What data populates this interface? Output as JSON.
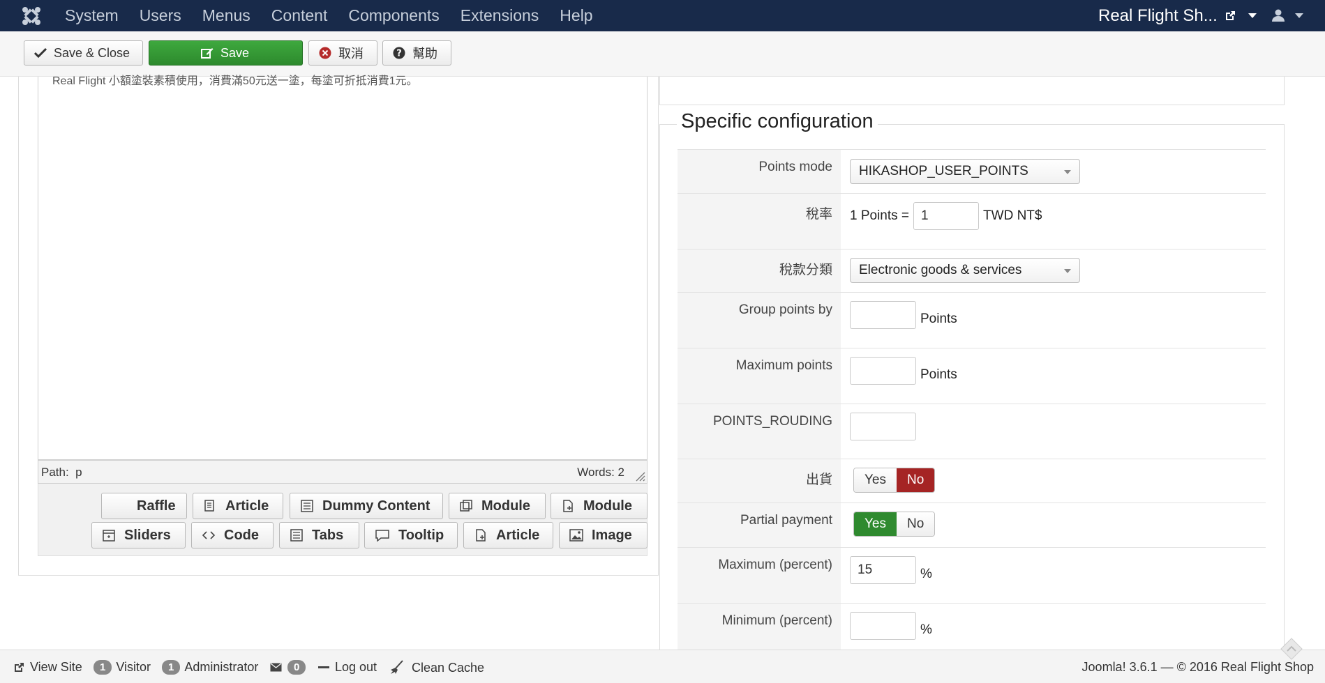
{
  "navbar": {
    "menu": [
      "System",
      "Users",
      "Menus",
      "Content",
      "Components",
      "Extensions",
      "Help"
    ],
    "site_name": "Real Flight Sh..."
  },
  "toolbar": {
    "save_close": "Save & Close",
    "save": "Save",
    "cancel": "取消",
    "help": "幫助"
  },
  "editor": {
    "text": "Real Flight 小額塗裝素積使用，消費滿50元送一塗，每塗可折抵消費1元。",
    "path_label": "Path:",
    "path_value": "p",
    "words_label": "Words: 2"
  },
  "editor_buttons": {
    "row1": [
      "Raffle",
      "Article",
      "Dummy Content",
      "Module",
      "Module"
    ],
    "row2": [
      "Sliders",
      "Code",
      "Tabs",
      "Tooltip",
      "Article",
      "Image"
    ]
  },
  "config": {
    "legend": "Specific configuration",
    "points_mode_label": "Points mode",
    "points_mode_value": "HIKASHOP_USER_POINTS",
    "rate_label": "稅率",
    "rate_prefix": "1 Points =",
    "rate_value": "1",
    "rate_suffix": "TWD NT$",
    "tax_category_label": "稅款分類",
    "tax_category_value": "Electronic goods & services",
    "group_points_label": "Group points by",
    "group_points_value": "",
    "group_points_unit": "Points",
    "max_points_label": "Maximum points",
    "max_points_value": "",
    "max_points_unit": "Points",
    "rounding_label": "POINTS_ROUDING",
    "rounding_value": "",
    "shipping_label": "出貨",
    "shipping_yes": "Yes",
    "shipping_no": "No",
    "partial_label": "Partial payment",
    "partial_yes": "Yes",
    "partial_no": "No",
    "max_percent_label": "Maximum (percent)",
    "max_percent_value": "15",
    "max_percent_unit": "%",
    "min_percent_label": "Minimum (percent)",
    "min_percent_value": "",
    "min_percent_unit": "%"
  },
  "footer": {
    "view_site": "View Site",
    "visitor_count": "1",
    "visitor_label": "Visitor",
    "admin_count": "1",
    "admin_label": "Administrator",
    "messages_count": "0",
    "logout": "Log out",
    "clean_cache": "Clean Cache",
    "copyright": "Joomla! 3.6.1  —  © 2016 Real Flight Shop"
  },
  "colors": {
    "navbar": "#182a4a",
    "success": "#2f8a2f",
    "danger": "#a52424"
  }
}
